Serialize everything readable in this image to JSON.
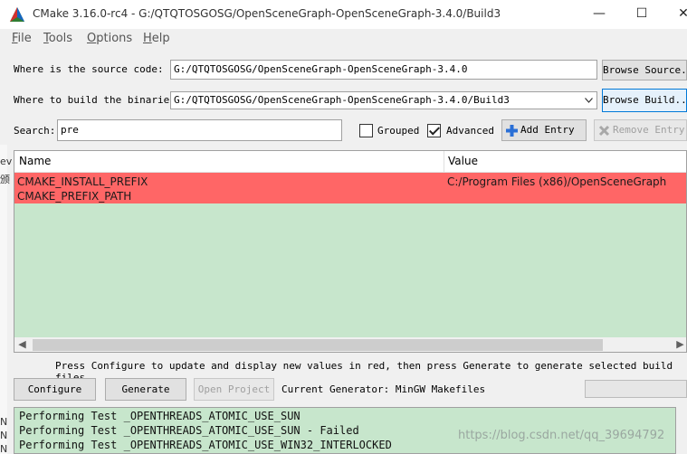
{
  "window": {
    "title": "CMake 3.16.0-rc4 - G:/QTQTOSGOSG/OpenSceneGraph-OpenSceneGraph-3.4.0/Build3",
    "minimize_glyph": "—",
    "maximize_glyph": "☐",
    "close_glyph": "✕"
  },
  "menu": {
    "file": {
      "accel": "F",
      "rest": "ile"
    },
    "tools": {
      "accel": "T",
      "rest": "ools"
    },
    "options": {
      "accel": "O",
      "rest": "ptions"
    },
    "help": {
      "accel": "H",
      "rest": "elp"
    }
  },
  "source": {
    "label": "Where is the source code:",
    "value": "G:/QTQTOSGOSG/OpenSceneGraph-OpenSceneGraph-3.4.0",
    "browse": "Browse Source..."
  },
  "binaries": {
    "label": "Where to build the binaries:",
    "value": "G:/QTQTOSGOSG/OpenSceneGraph-OpenSceneGraph-3.4.0/Build3",
    "browse": "Browse Build..."
  },
  "search": {
    "label": "Search:",
    "value": "pre",
    "grouped_label": "Grouped",
    "grouped_checked": false,
    "advanced_label": "Advanced",
    "advanced_checked": true,
    "add_entry": "Add Entry",
    "remove_entry": "Remove Entry"
  },
  "table": {
    "headers": {
      "name": "Name",
      "value": "Value"
    },
    "rows": [
      {
        "name": "CMAKE_INSTALL_PREFIX",
        "value": "C:/Program Files (x86)/OpenSceneGraph"
      },
      {
        "name": "CMAKE_PREFIX_PATH",
        "value": ""
      }
    ],
    "new_row_color": "#ff6666",
    "bg_color": "#c7e6cc"
  },
  "hint": "Press Configure to update and display new values in red, then press Generate to generate selected build files.",
  "actions": {
    "configure": "Configure",
    "generate": "Generate",
    "open_project": "Open Project",
    "generator_text": "Current Generator: MinGW Makefiles"
  },
  "output": {
    "lines": [
      "Performing Test _OPENTHREADS_ATOMIC_USE_SUN",
      "Performing Test _OPENTHREADS_ATOMIC_USE_SUN - Failed",
      "Performing Test _OPENTHREADS_ATOMIC_USE_WIN32_INTERLOCKED"
    ],
    "watermark": "https://blog.csdn.net/qq_39694792"
  },
  "behind_window": {
    "chars": [
      "ev",
      "颁",
      "N",
      "N",
      "N"
    ]
  }
}
